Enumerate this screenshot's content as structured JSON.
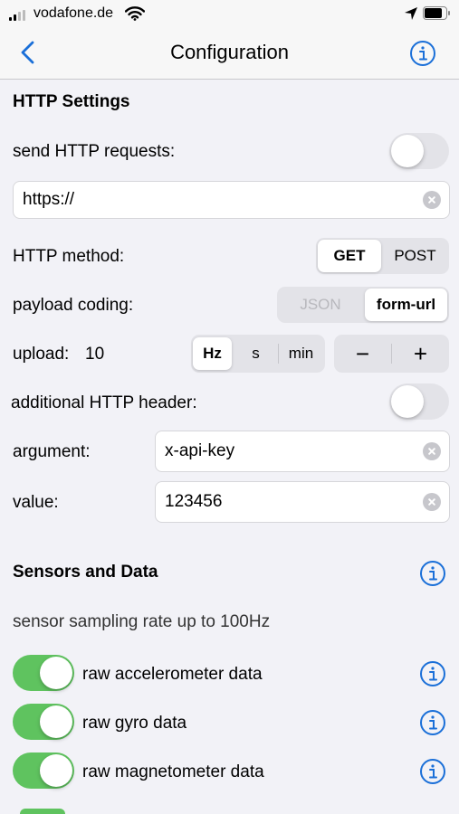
{
  "status_bar": {
    "carrier": "vodafone.de"
  },
  "nav": {
    "title": "Configuration"
  },
  "http": {
    "section_title": "HTTP Settings",
    "send_label": "send HTTP requests:",
    "url_value": "https://",
    "method_label": "HTTP method:",
    "method_options": [
      "GET",
      "POST"
    ],
    "method_selected": "GET",
    "coding_label": "payload coding:",
    "coding_options": [
      "JSON",
      "form-url"
    ],
    "coding_selected": "form-url",
    "upload_label": "upload:",
    "upload_value": "10",
    "unit_options": [
      "Hz",
      "s",
      "min"
    ],
    "unit_selected": "Hz",
    "stepper_minus": "−",
    "stepper_plus": "+",
    "header_label": "additional HTTP header:",
    "argument_label": "argument:",
    "argument_value": "x-api-key",
    "value_label": "value:",
    "value_value": "123456"
  },
  "sensors": {
    "section_title": "Sensors and Data",
    "rate_text": "sensor sampling rate up to 100Hz",
    "items": [
      {
        "label": "raw accelerometer data"
      },
      {
        "label": "raw gyro data"
      },
      {
        "label": "raw magnetometer data"
      }
    ]
  },
  "colors": {
    "accent": "#1a6fd8",
    "toggle_on": "#5fc35f",
    "toggle_off": "#e3e3e8"
  }
}
